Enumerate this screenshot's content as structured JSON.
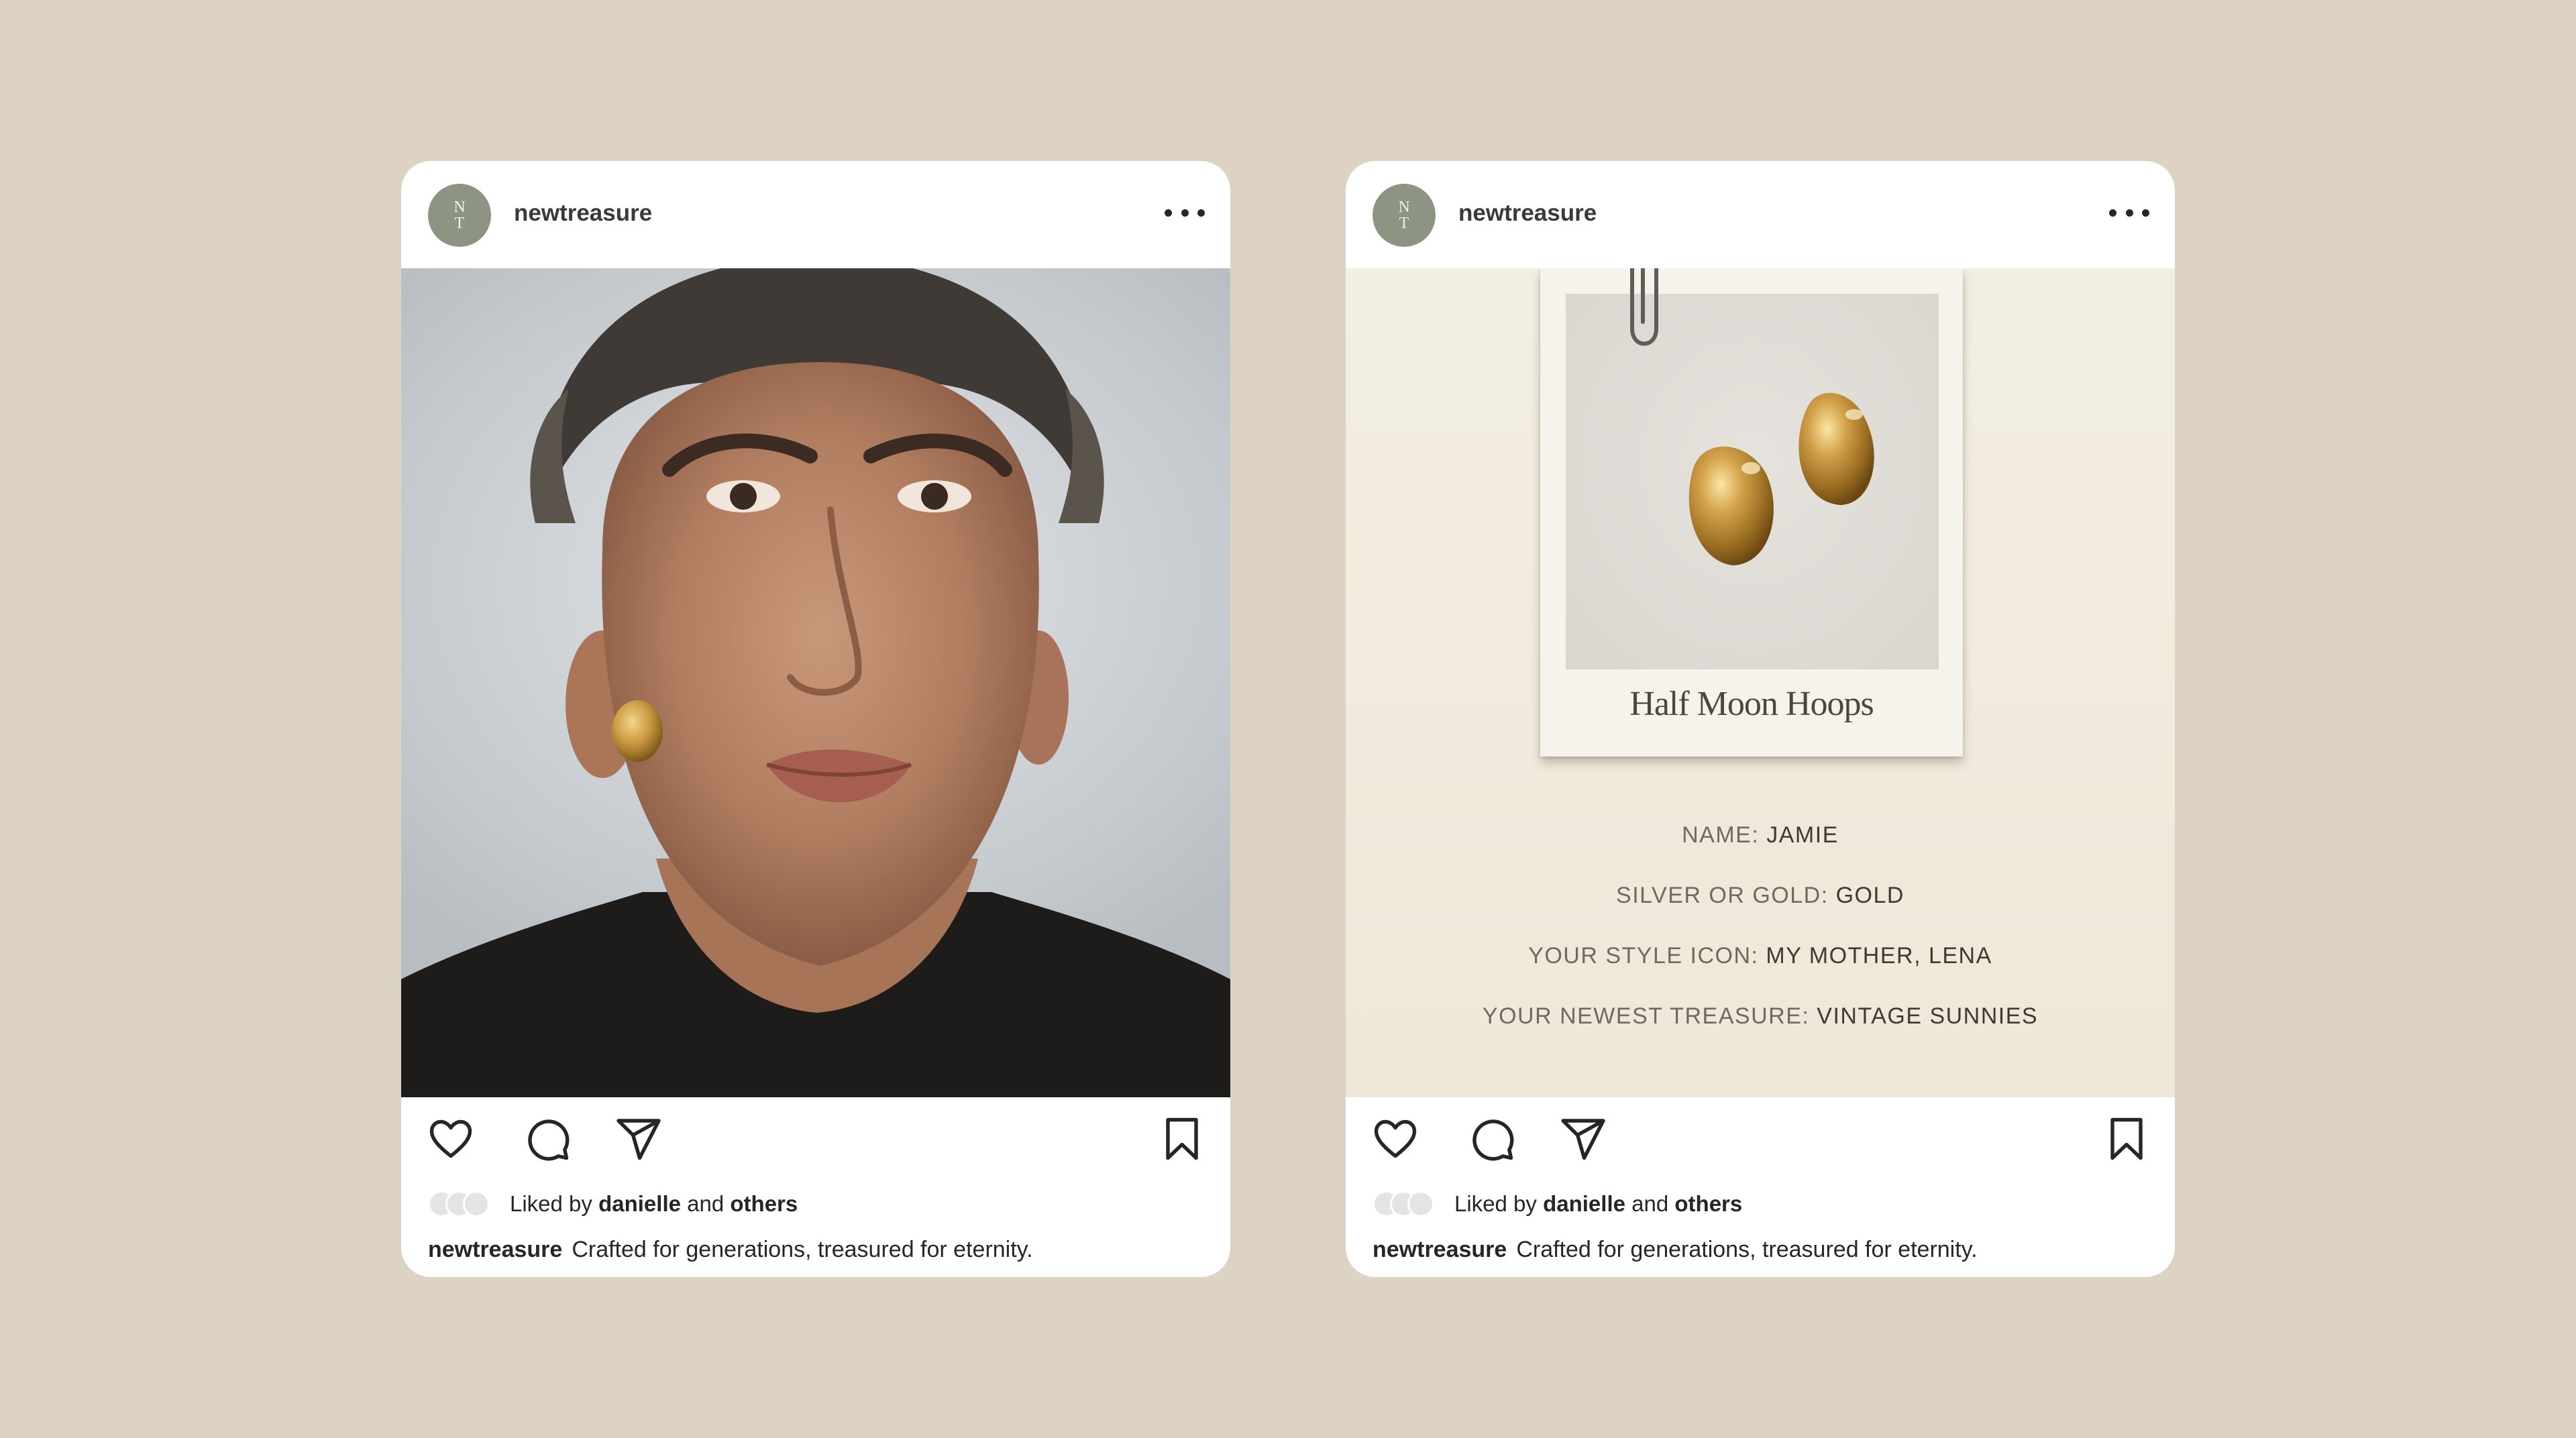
{
  "colors": {
    "background": "#ddd3c2",
    "card": "#ffffff",
    "avatar": "#8e9482"
  },
  "posts": [
    {
      "account": {
        "avatar_initials_top": "N",
        "avatar_initials_bottom": "T",
        "username": "newtreasure"
      },
      "media": "portrait-photo",
      "likes": {
        "prefix": "Liked by",
        "user": "danielle",
        "conjunction": "and",
        "others": "others"
      },
      "caption": {
        "username": "newtreasure",
        "text": "Crafted for generations, treasured for eternity."
      }
    },
    {
      "account": {
        "avatar_initials_top": "N",
        "avatar_initials_bottom": "T",
        "username": "newtreasure"
      },
      "media": "product-card",
      "card": {
        "polaroid_caption": "Half Moon Hoops",
        "questions": [
          {
            "label": "NAME:",
            "answer": "JAMIE"
          },
          {
            "label": "SILVER OR GOLD:",
            "answer": "GOLD"
          },
          {
            "label": "YOUR STYLE ICON:",
            "answer": "MY MOTHER, LENA"
          },
          {
            "label": "YOUR NEWEST TREASURE:",
            "answer": "VINTAGE SUNNIES"
          }
        ]
      },
      "likes": {
        "prefix": "Liked by",
        "user": "danielle",
        "conjunction": "and",
        "others": "others"
      },
      "caption": {
        "username": "newtreasure",
        "text": "Crafted for generations, treasured for eternity."
      }
    }
  ],
  "icons": [
    "heart-icon",
    "comment-icon",
    "share-icon",
    "bookmark-icon",
    "more-options-icon",
    "paperclip-icon"
  ]
}
